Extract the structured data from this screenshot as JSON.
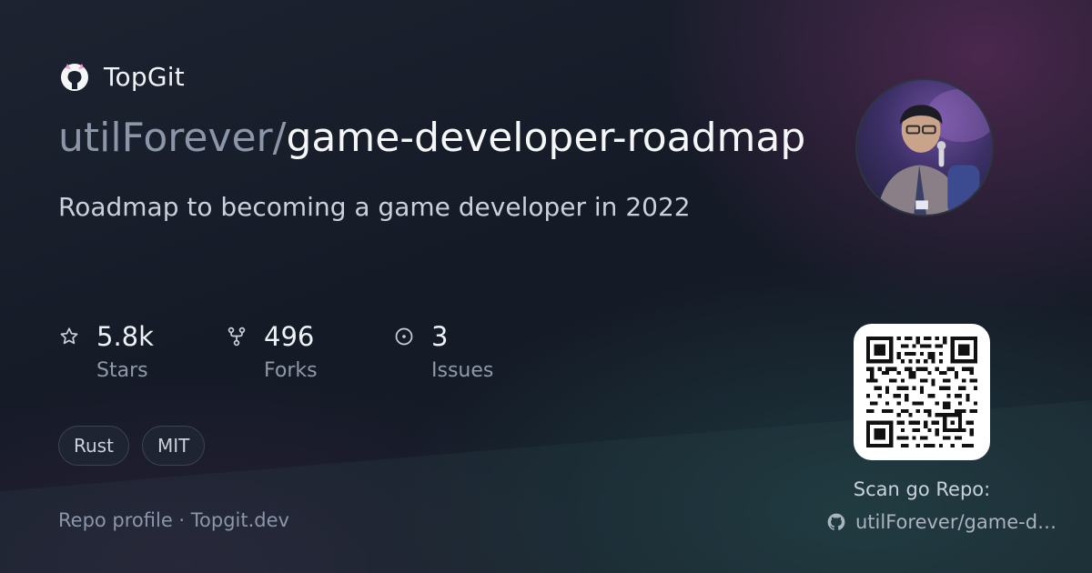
{
  "brand": {
    "name": "TopGit",
    "icon": "github-cat-icon"
  },
  "repo": {
    "owner": "utilForever/",
    "name": "game-developer-roadmap",
    "description": "Roadmap to becoming a game developer in 2022"
  },
  "stats": [
    {
      "icon": "star-icon",
      "value": "5.8k",
      "label": "Stars"
    },
    {
      "icon": "fork-icon",
      "value": "496",
      "label": "Forks"
    },
    {
      "icon": "issue-icon",
      "value": "3",
      "label": "Issues"
    }
  ],
  "tags": [
    "Rust",
    "MIT"
  ],
  "footer": {
    "link_text": "Repo profile · Topgit.dev"
  },
  "qr_panel": {
    "scan_label": "Scan go Repo:",
    "repo_short": "utilForever/game-de...",
    "icon": "github-icon"
  },
  "colors": {
    "owner_text": "#8b96a8",
    "title_text": "#f4f6f8",
    "muted_text": "#8f99a8",
    "accent_pink": "#f29bd3"
  }
}
